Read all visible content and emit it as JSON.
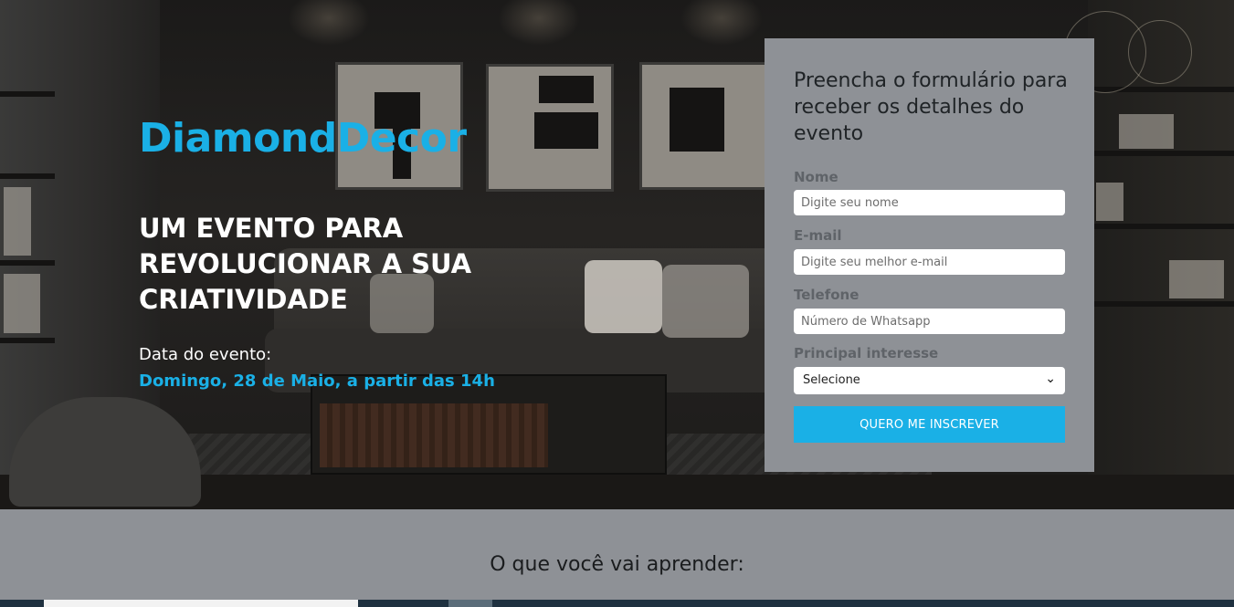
{
  "hero": {
    "brand": "DiamondDecor",
    "headline": "UM EVENTO PARA REVOLUCIONAR A SUA CRIATIVIDADE",
    "date_label": "Data do evento:",
    "date_value": "Domingo, 28 de Maio, a partir das 14h"
  },
  "form": {
    "title": "Preencha o formulário para receber os detalhes do evento",
    "fields": [
      {
        "label": "Nome",
        "placeholder": "Digite seu nome"
      },
      {
        "label": "E-mail",
        "placeholder": "Digite seu melhor e-mail"
      },
      {
        "label": "Telefone",
        "placeholder": "Número de Whatsapp"
      }
    ],
    "interest": {
      "label": "Principal interesse",
      "selected": "Selecione"
    },
    "submit_label": "QUERO ME INSCREVER"
  },
  "lower": {
    "title": "O que você vai aprender:"
  },
  "colors": {
    "accent": "#1ab0e6",
    "panel": "#8e9196",
    "taskbar": "#1f3140"
  },
  "icons": {
    "select_chevron": "chevron-down-icon"
  }
}
